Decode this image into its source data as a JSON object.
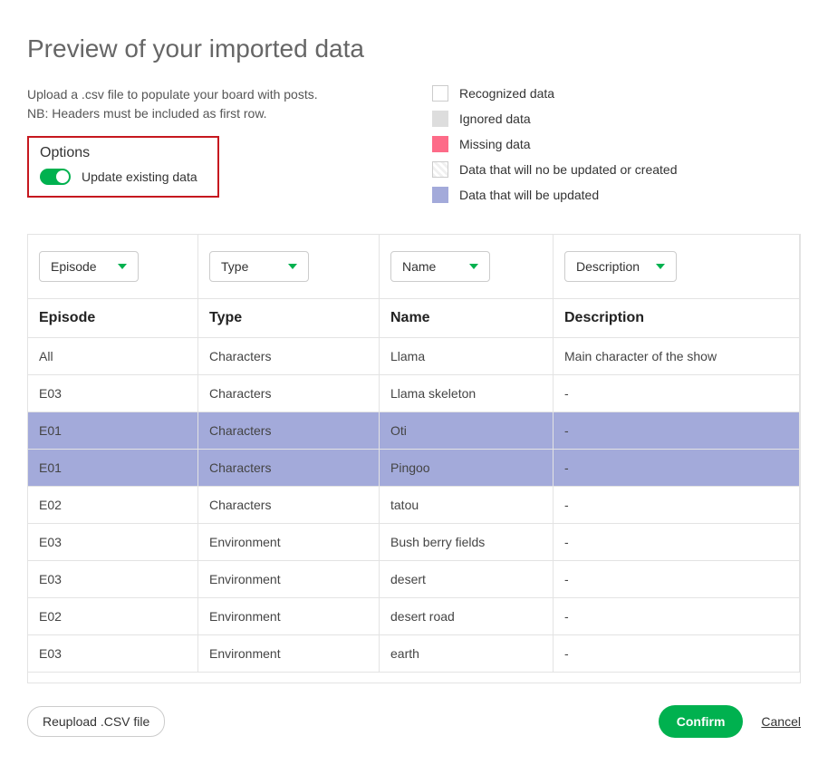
{
  "title": "Preview of your imported data",
  "instructions_line1": "Upload a .csv file to populate your board with posts.",
  "instructions_line2": "NB: Headers must be included as first row.",
  "options": {
    "heading": "Options",
    "update_label": "Update existing data",
    "update_enabled": true
  },
  "legend": {
    "recognized": "Recognized data",
    "ignored": "Ignored data",
    "missing": "Missing data",
    "no_update": "Data that will no be updated or created",
    "updated": "Data that will be updated"
  },
  "columns": [
    {
      "dropdown": "Episode",
      "header": "Episode"
    },
    {
      "dropdown": "Type",
      "header": "Type"
    },
    {
      "dropdown": "Name",
      "header": "Name"
    },
    {
      "dropdown": "Description",
      "header": "Description"
    }
  ],
  "rows": [
    {
      "state": "normal",
      "cells": [
        "All",
        "Characters",
        "Llama",
        "Main character of the show"
      ]
    },
    {
      "state": "normal",
      "cells": [
        "E03",
        "Characters",
        "Llama skeleton",
        "-"
      ]
    },
    {
      "state": "updated",
      "cells": [
        "E01",
        "Characters",
        "Oti",
        "-"
      ]
    },
    {
      "state": "updated",
      "cells": [
        "E01",
        "Characters",
        "Pingoo",
        "-"
      ]
    },
    {
      "state": "normal",
      "cells": [
        "E02",
        "Characters",
        "tatou",
        "-"
      ]
    },
    {
      "state": "normal",
      "cells": [
        "E03",
        "Environment",
        "Bush berry fields",
        "-"
      ]
    },
    {
      "state": "normal",
      "cells": [
        "E03",
        "Environment",
        "desert",
        "-"
      ]
    },
    {
      "state": "normal",
      "cells": [
        "E02",
        "Environment",
        "desert road",
        "-"
      ]
    },
    {
      "state": "normal",
      "cells": [
        "E03",
        "Environment",
        "earth",
        "-"
      ]
    }
  ],
  "buttons": {
    "reupload": "Reupload .CSV file",
    "confirm": "Confirm",
    "cancel": "Cancel"
  }
}
